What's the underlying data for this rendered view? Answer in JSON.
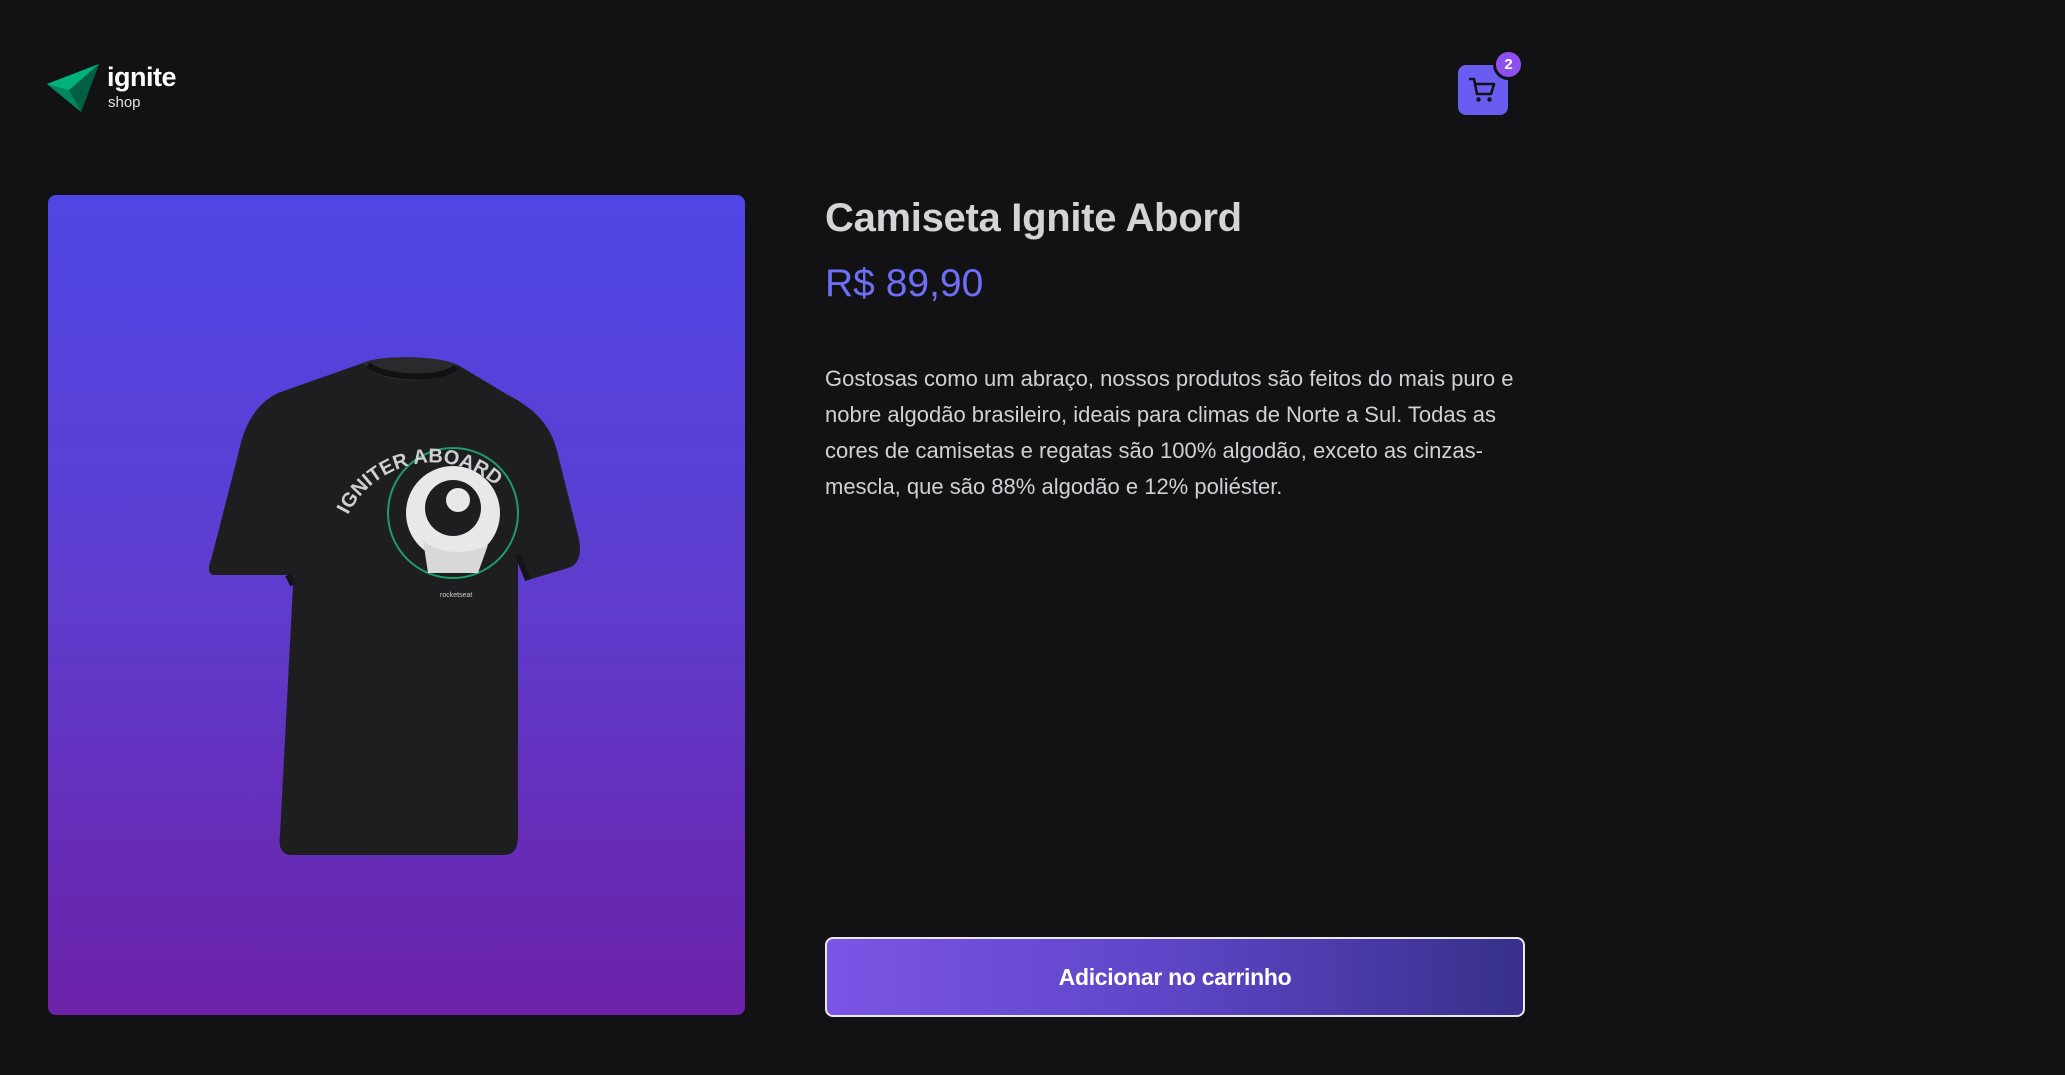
{
  "header": {
    "logo": {
      "name": "ignite",
      "subtitle": "shop",
      "icon": "ignite-logo-icon"
    },
    "cart": {
      "icon": "cart-icon",
      "count": "2",
      "color": "#6a5cf0",
      "badge_color": "#8e4ff0"
    }
  },
  "product": {
    "image": {
      "description_icon": "t-shirt-image",
      "print_text": "IGNITER ABOARD",
      "brand_text": "rocketseat"
    },
    "title": "Camiseta Ignite Abord",
    "price": "R$ 89,90",
    "description": "Gostosas como um abraço, nossos produtos são feitos do mais puro e nobre algodão brasileiro, ideais para climas de Norte a Sul. Todas as cores de camisetas e regatas são 100% algodão, exceto as cinzas-mescla, que são 88% algodão e 12% poliéster.",
    "add_to_cart_label": "Adicionar no carrinho"
  },
  "colors": {
    "background": "#121214",
    "accent": "#6e6ef7",
    "image_gradient_top": "#4f46e5",
    "image_gradient_bottom": "#6b21a8"
  }
}
